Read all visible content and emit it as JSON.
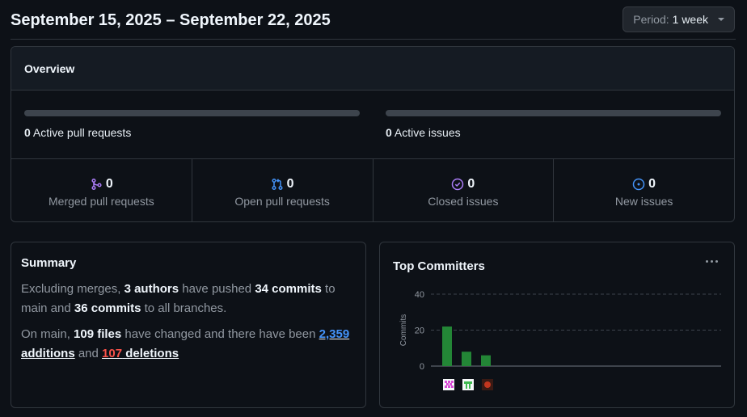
{
  "header": {
    "date_range": "September 15, 2025 – September 22, 2025",
    "period_label": "Period:",
    "period_value": "1 week"
  },
  "overview": {
    "title": "Overview",
    "active_pull_requests": {
      "count": "0",
      "label": "Active pull requests",
      "fill_fraction": 0
    },
    "active_issues": {
      "count": "0",
      "label": "Active issues",
      "fill_fraction": 0
    },
    "stats": [
      {
        "icon": "git-merge-icon",
        "count": "0",
        "label": "Merged pull requests",
        "color": "#ab7df8"
      },
      {
        "icon": "git-pull-request-icon",
        "count": "0",
        "label": "Open pull requests",
        "color": "#4493f8"
      },
      {
        "icon": "issue-closed-icon",
        "count": "0",
        "label": "Closed issues",
        "color": "#ab7df8"
      },
      {
        "icon": "issue-opened-icon",
        "count": "0",
        "label": "New issues",
        "color": "#4493f8"
      }
    ]
  },
  "summary": {
    "title": "Summary",
    "p1_a": "Excluding merges, ",
    "authors": "3 authors",
    "p1_b": " have pushed ",
    "commits_main": "34 commits",
    "p1_c": " to main and ",
    "commits_all": "36 commits",
    "p1_d": " to all branches.",
    "p2_a": "On main, ",
    "files": "109 files",
    "p2_b": " have changed and there have been ",
    "additions_num": "2,359",
    "additions_word": " additions",
    "p2_c": " and ",
    "deletions_num": "107",
    "deletions_word": " deletions"
  },
  "top_committers": {
    "title": "Top Committers",
    "menu_icon": "kebab-horizontal-icon"
  },
  "chart_data": {
    "type": "bar",
    "ylabel": "Commits",
    "ylim": [
      0,
      40
    ],
    "yticks": [
      "40",
      "20",
      "0"
    ],
    "categories": [
      "committer-1",
      "committer-2",
      "committer-3"
    ],
    "values": [
      22,
      8,
      6
    ],
    "bar_color": "#238636",
    "grid": true,
    "avatar_colors": [
      "#d94fd6",
      "#3fb950",
      "#c2361f"
    ]
  }
}
